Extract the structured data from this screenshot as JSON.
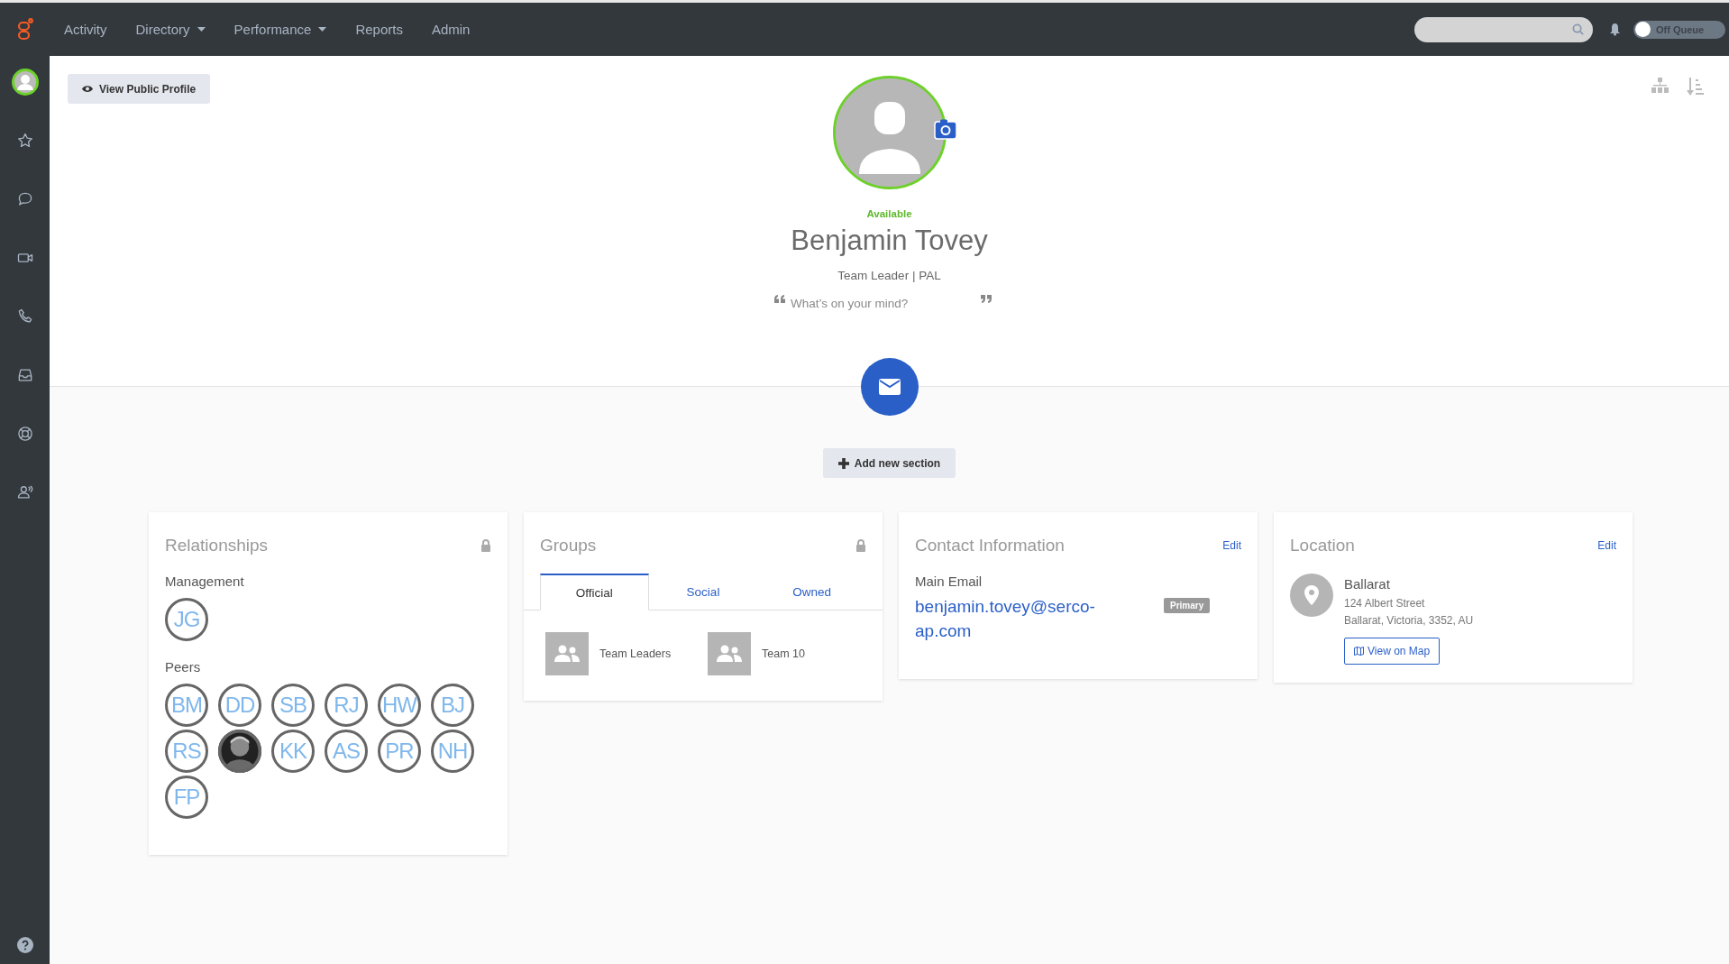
{
  "nav": {
    "items": [
      {
        "label": "Activity",
        "dropdown": false
      },
      {
        "label": "Directory",
        "dropdown": true
      },
      {
        "label": "Performance",
        "dropdown": true
      },
      {
        "label": "Reports",
        "dropdown": false
      },
      {
        "label": "Admin",
        "dropdown": false
      }
    ]
  },
  "queue_toggle": {
    "label": "Off Queue",
    "on": false
  },
  "view_public_profile": "View Public Profile",
  "profile": {
    "status": "Available",
    "name": "Benjamin Tovey",
    "title": "Team Leader | PAL",
    "placeholder": "What’s on your mind?"
  },
  "add_section": "Add new section",
  "relationships": {
    "title": "Relationships",
    "locked": true,
    "sections": [
      {
        "label": "Management",
        "people": [
          {
            "kind": "initials",
            "initials": "JG"
          }
        ]
      },
      {
        "label": "Peers",
        "people": [
          {
            "kind": "initials",
            "initials": "BM"
          },
          {
            "kind": "initials",
            "initials": "DD"
          },
          {
            "kind": "initials",
            "initials": "SB"
          },
          {
            "kind": "initials",
            "initials": "RJ"
          },
          {
            "kind": "initials",
            "initials": "HW"
          },
          {
            "kind": "initials",
            "initials": "BJ"
          },
          {
            "kind": "initials",
            "initials": "RS"
          },
          {
            "kind": "picture"
          },
          {
            "kind": "initials",
            "initials": "KK"
          },
          {
            "kind": "initials",
            "initials": "AS"
          },
          {
            "kind": "initials",
            "initials": "PR"
          },
          {
            "kind": "initials",
            "initials": "NH"
          },
          {
            "kind": "initials",
            "initials": "FP"
          }
        ]
      }
    ]
  },
  "groups": {
    "title": "Groups",
    "locked": true,
    "tabs": [
      {
        "label": "Official",
        "selected": true
      },
      {
        "label": "Social",
        "selected": false
      },
      {
        "label": "Owned",
        "selected": false
      }
    ],
    "items": [
      "Team Leaders",
      "Team 10"
    ]
  },
  "contact": {
    "title": "Contact Information",
    "edit": "Edit",
    "label": "Main Email",
    "email": "benjamin.tovey@serco-ap.com",
    "badge": "Primary"
  },
  "location": {
    "title": "Location",
    "edit": "Edit",
    "city": "Ballarat",
    "street": "124 Albert Street",
    "region": "Ballarat, Victoria, 3352, AU",
    "map_button": "View on Map"
  }
}
